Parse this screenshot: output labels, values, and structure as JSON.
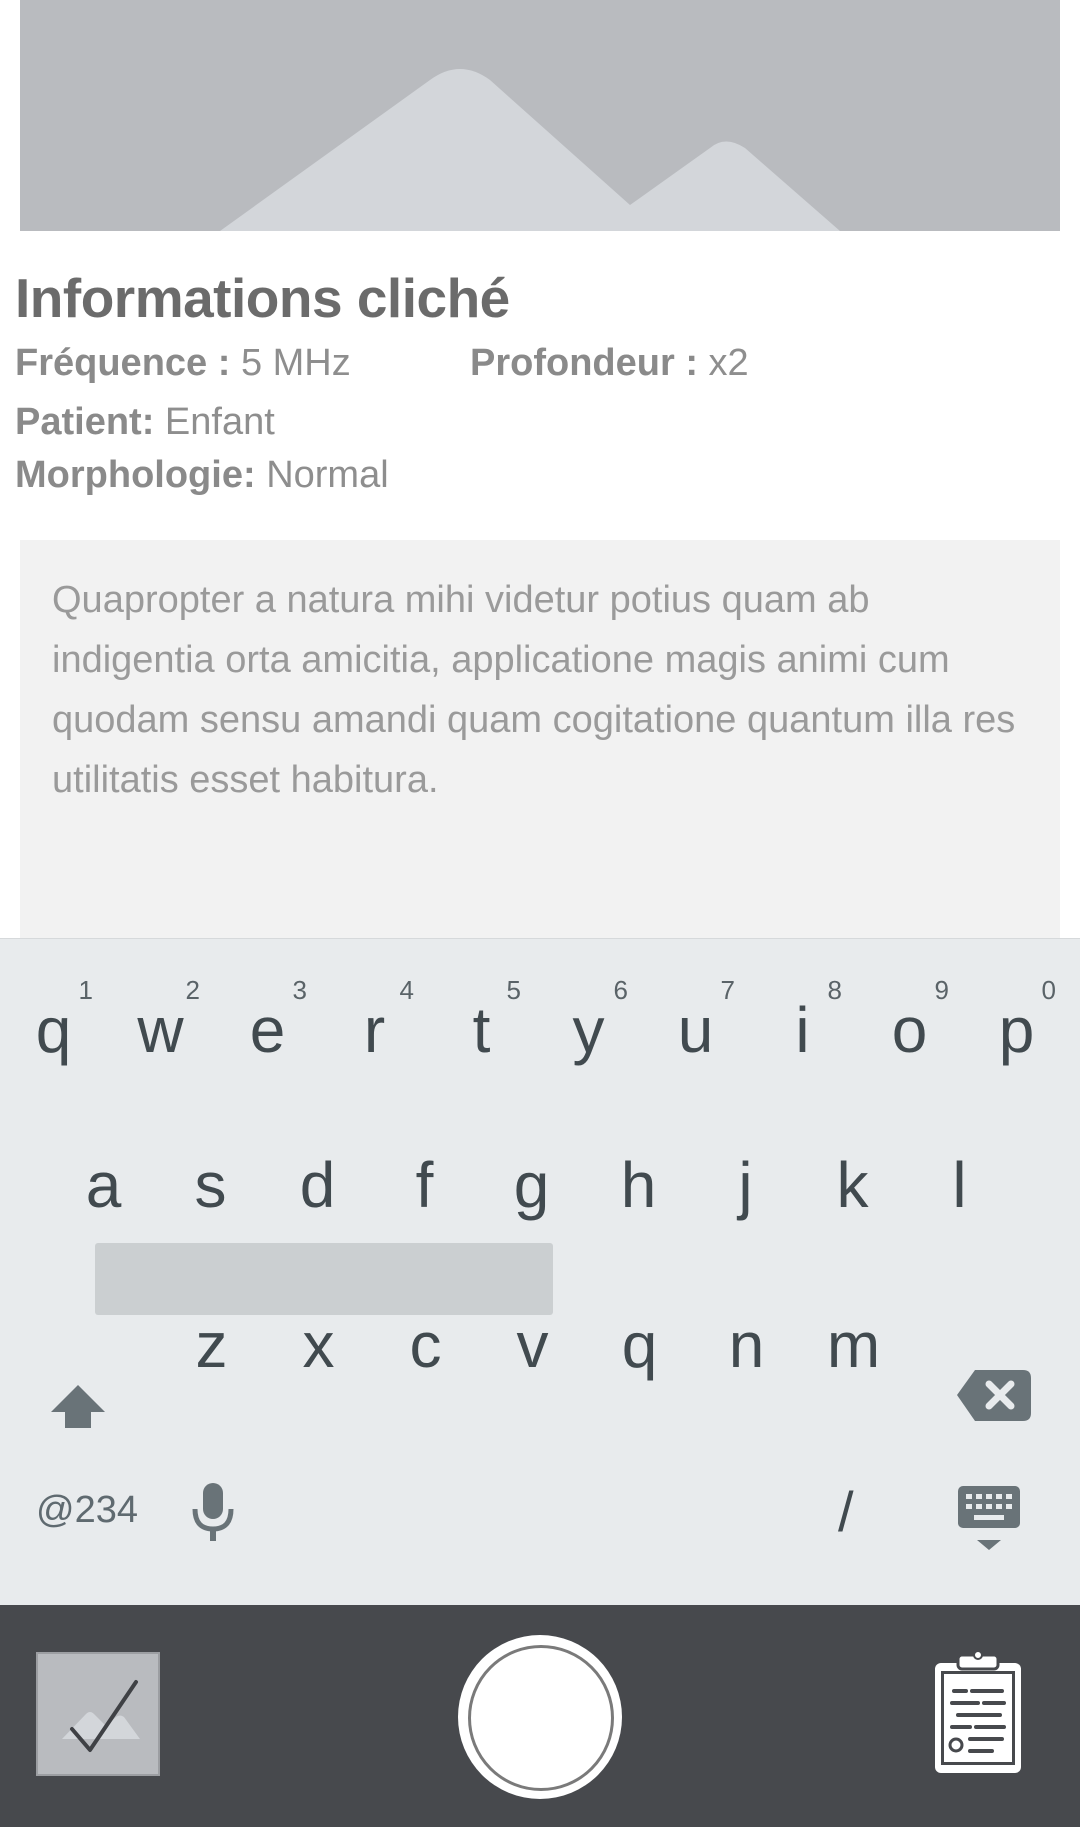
{
  "info": {
    "title": "Informations cliché",
    "frequence_label": "Fréquence :",
    "frequence_value": "5 MHz",
    "profondeur_label": "Profondeur :",
    "profondeur_value": "x2",
    "patient_label": "Patient:",
    "patient_value": "Enfant",
    "morphologie_label": "Morphologie:",
    "morphologie_value": "Normal"
  },
  "note": {
    "text": "Quapropter a natura mihi videtur potius quam ab indigentia orta amicitia, applicatione magis animi cum quodam sensu amandi quam cogitatione quantum illa res utilitatis esset habitura."
  },
  "keyboard": {
    "row1": [
      {
        "key": "q",
        "hint": "1"
      },
      {
        "key": "w",
        "hint": "2"
      },
      {
        "key": "e",
        "hint": "3"
      },
      {
        "key": "r",
        "hint": "4"
      },
      {
        "key": "t",
        "hint": "5"
      },
      {
        "key": "y",
        "hint": "6"
      },
      {
        "key": "u",
        "hint": "7"
      },
      {
        "key": "i",
        "hint": "8"
      },
      {
        "key": "o",
        "hint": "9"
      },
      {
        "key": "p",
        "hint": "0"
      }
    ],
    "row2": [
      "a",
      "s",
      "d",
      "f",
      "g",
      "h",
      "j",
      "k",
      "l"
    ],
    "row3": [
      "z",
      "x",
      "c",
      "v",
      "q",
      "n",
      "m"
    ],
    "symbols_label": "@234",
    "slash_label": "/",
    "icons": {
      "shift": "shift-icon",
      "backspace": "backspace-icon",
      "mic": "microphone-icon",
      "hide": "keyboard-hide-icon"
    }
  },
  "bottom_bar": {
    "icons": {
      "thumbnail": "image-check-icon",
      "capture": "shutter-icon",
      "report": "clipboard-report-icon"
    }
  },
  "colors": {
    "keyboard_bg": "#e8ebed",
    "bottom_bar_bg": "#47494d",
    "note_bg": "#f2f2f2",
    "preview_bg": "#b9bbbf"
  }
}
